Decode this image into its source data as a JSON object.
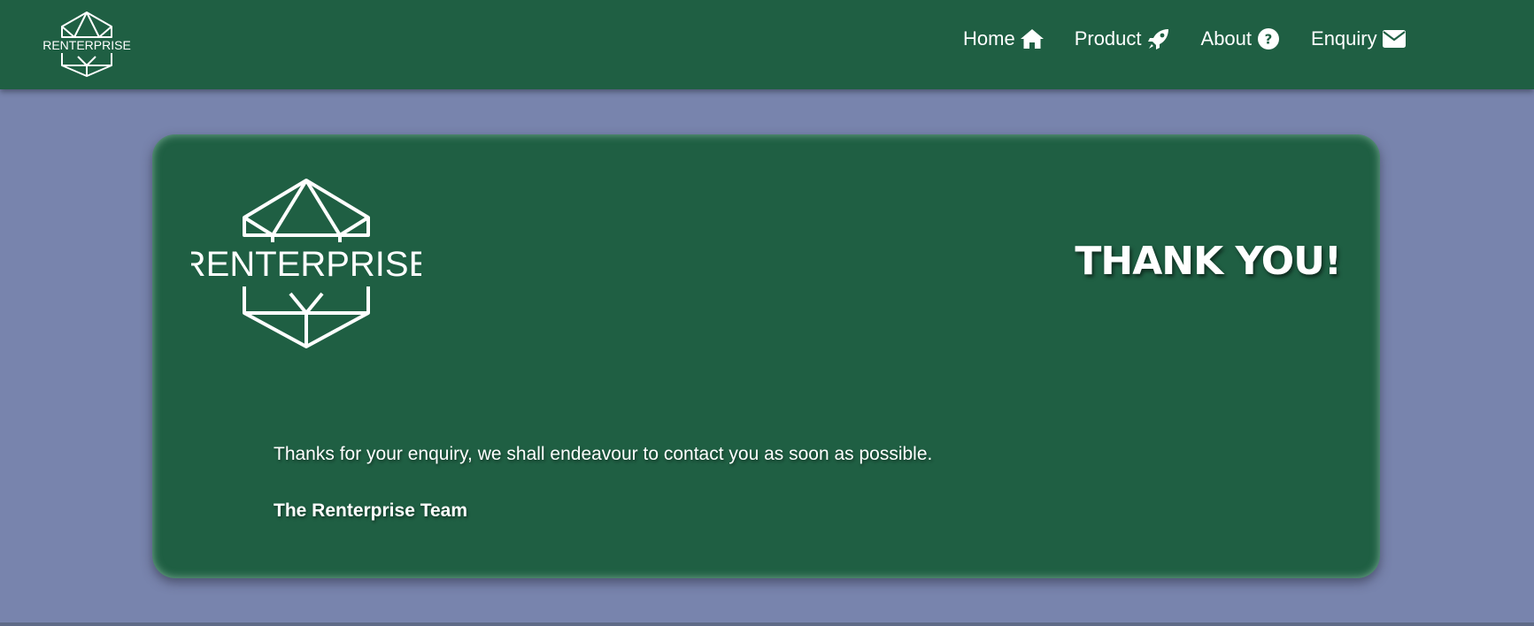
{
  "colors": {
    "background": "#7884ad",
    "brand_green": "#1f5f43",
    "text": "#ffffff"
  },
  "nav": {
    "logo_text": "RENTERPRISE",
    "links": [
      {
        "label": "Home",
        "icon": "home-icon"
      },
      {
        "label": "Product",
        "icon": "rocket-icon"
      },
      {
        "label": "About",
        "icon": "question-circle-icon"
      },
      {
        "label": "Enquiry",
        "icon": "envelope-icon"
      }
    ]
  },
  "card": {
    "logo_text": "RENTERPRISE",
    "title": "THANK YOU!",
    "message": "Thanks for your enquiry, we shall endeavour to contact you as soon as possible.",
    "signature": "The Renterprise Team"
  }
}
